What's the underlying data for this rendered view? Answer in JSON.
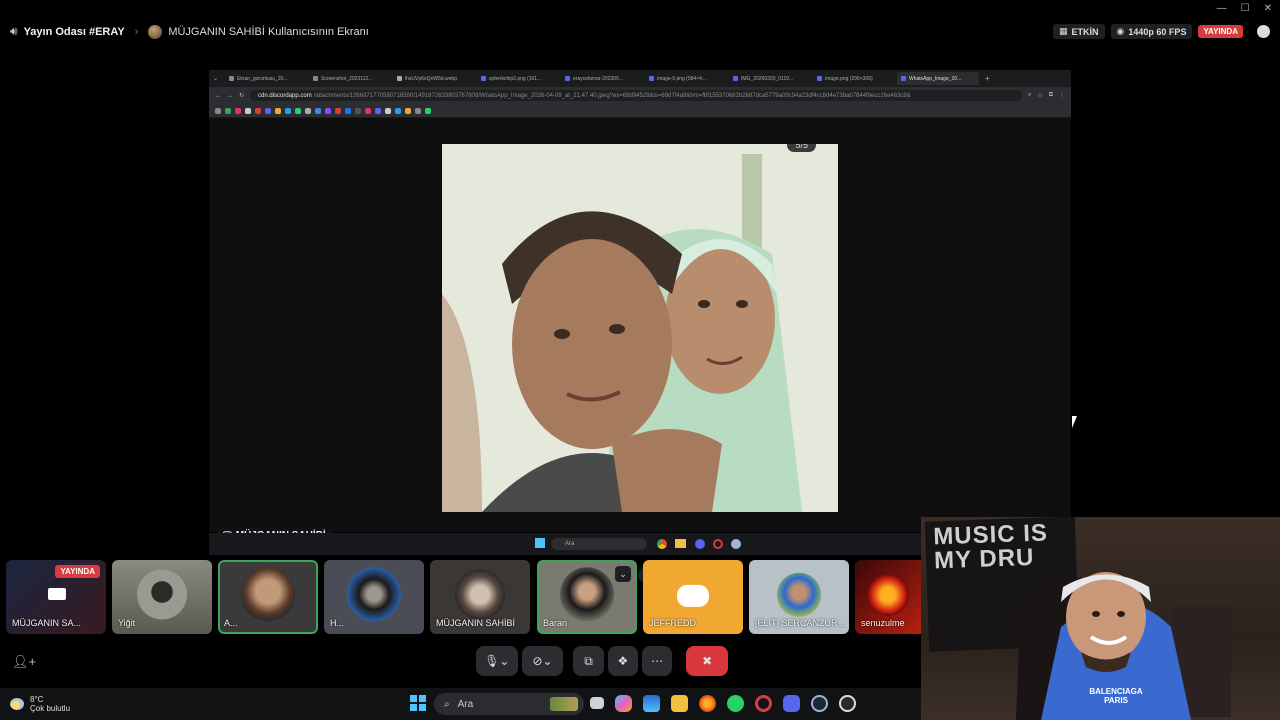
{
  "topbar": {
    "room_name": "Yayın Odası #ERAY",
    "screen_owner": "MÜJGANIN SAHİBİ Kullanıcısının Ekranı",
    "activity_label": "ETKİN",
    "quality_label": "1440p 60 FPS",
    "live_label": "YAYINDA"
  },
  "browser": {
    "tabs": [
      {
        "label": "Ekran_goruntusu_20..."
      },
      {
        "label": "Screenshot_2023112..."
      },
      {
        "label": "ihsUVp6oQnW5d.webp"
      },
      {
        "label": "ayberkchip2.png (161..."
      },
      {
        "label": "erayozkenar-202300..."
      },
      {
        "label": "image-9.png (584×4..."
      },
      {
        "label": "IMG_20260320_0110..."
      },
      {
        "label": "image.png (296×306)"
      },
      {
        "label": "WhatsApp_Image_20..."
      }
    ],
    "url_domain": "cdn.discordapp.com",
    "url_path": "/attachments/1266871770580718590/1491872633803767808/WhatsApp_Image_2026-04-09_at_21.47.40.jpeg?ex=69d94529&is=69d7f4a9&hm=f6f155370682b2687dca5779a09c94a23df4cc8d4e73bab7844f8ecc26e463c8&",
    "image_counter": "5/5"
  },
  "share": {
    "owner_tag": "MÜJGANIN SAHİBİ",
    "inner_search_placeholder": "Ara"
  },
  "participants": [
    {
      "name": "MÜJGANIN SA...",
      "badge": "YAYINDA"
    },
    {
      "name": "Yiğit"
    },
    {
      "name": "A..."
    },
    {
      "name": "H..."
    },
    {
      "name": "MÜJGANIN SAHİBİ"
    },
    {
      "name": "Baran"
    },
    {
      "name": "JEFFREDD"
    },
    {
      "name": "[ELIT] SERCANZUR..."
    },
    {
      "name": "senuzulme"
    }
  ],
  "webcam": {
    "poster_text": "MUSIC IS MY DRU",
    "shirt_text": "BALENCIAGA PARIS"
  },
  "taskbar": {
    "temperature": "8°C",
    "weather": "Çok bulutlu",
    "search_placeholder": "Ara"
  },
  "colors": {
    "live_red": "#d83c3e",
    "speaking_green": "#3ba55c",
    "discord_blurple": "#5865f2",
    "jeffredd_tile": "#f0a830"
  }
}
